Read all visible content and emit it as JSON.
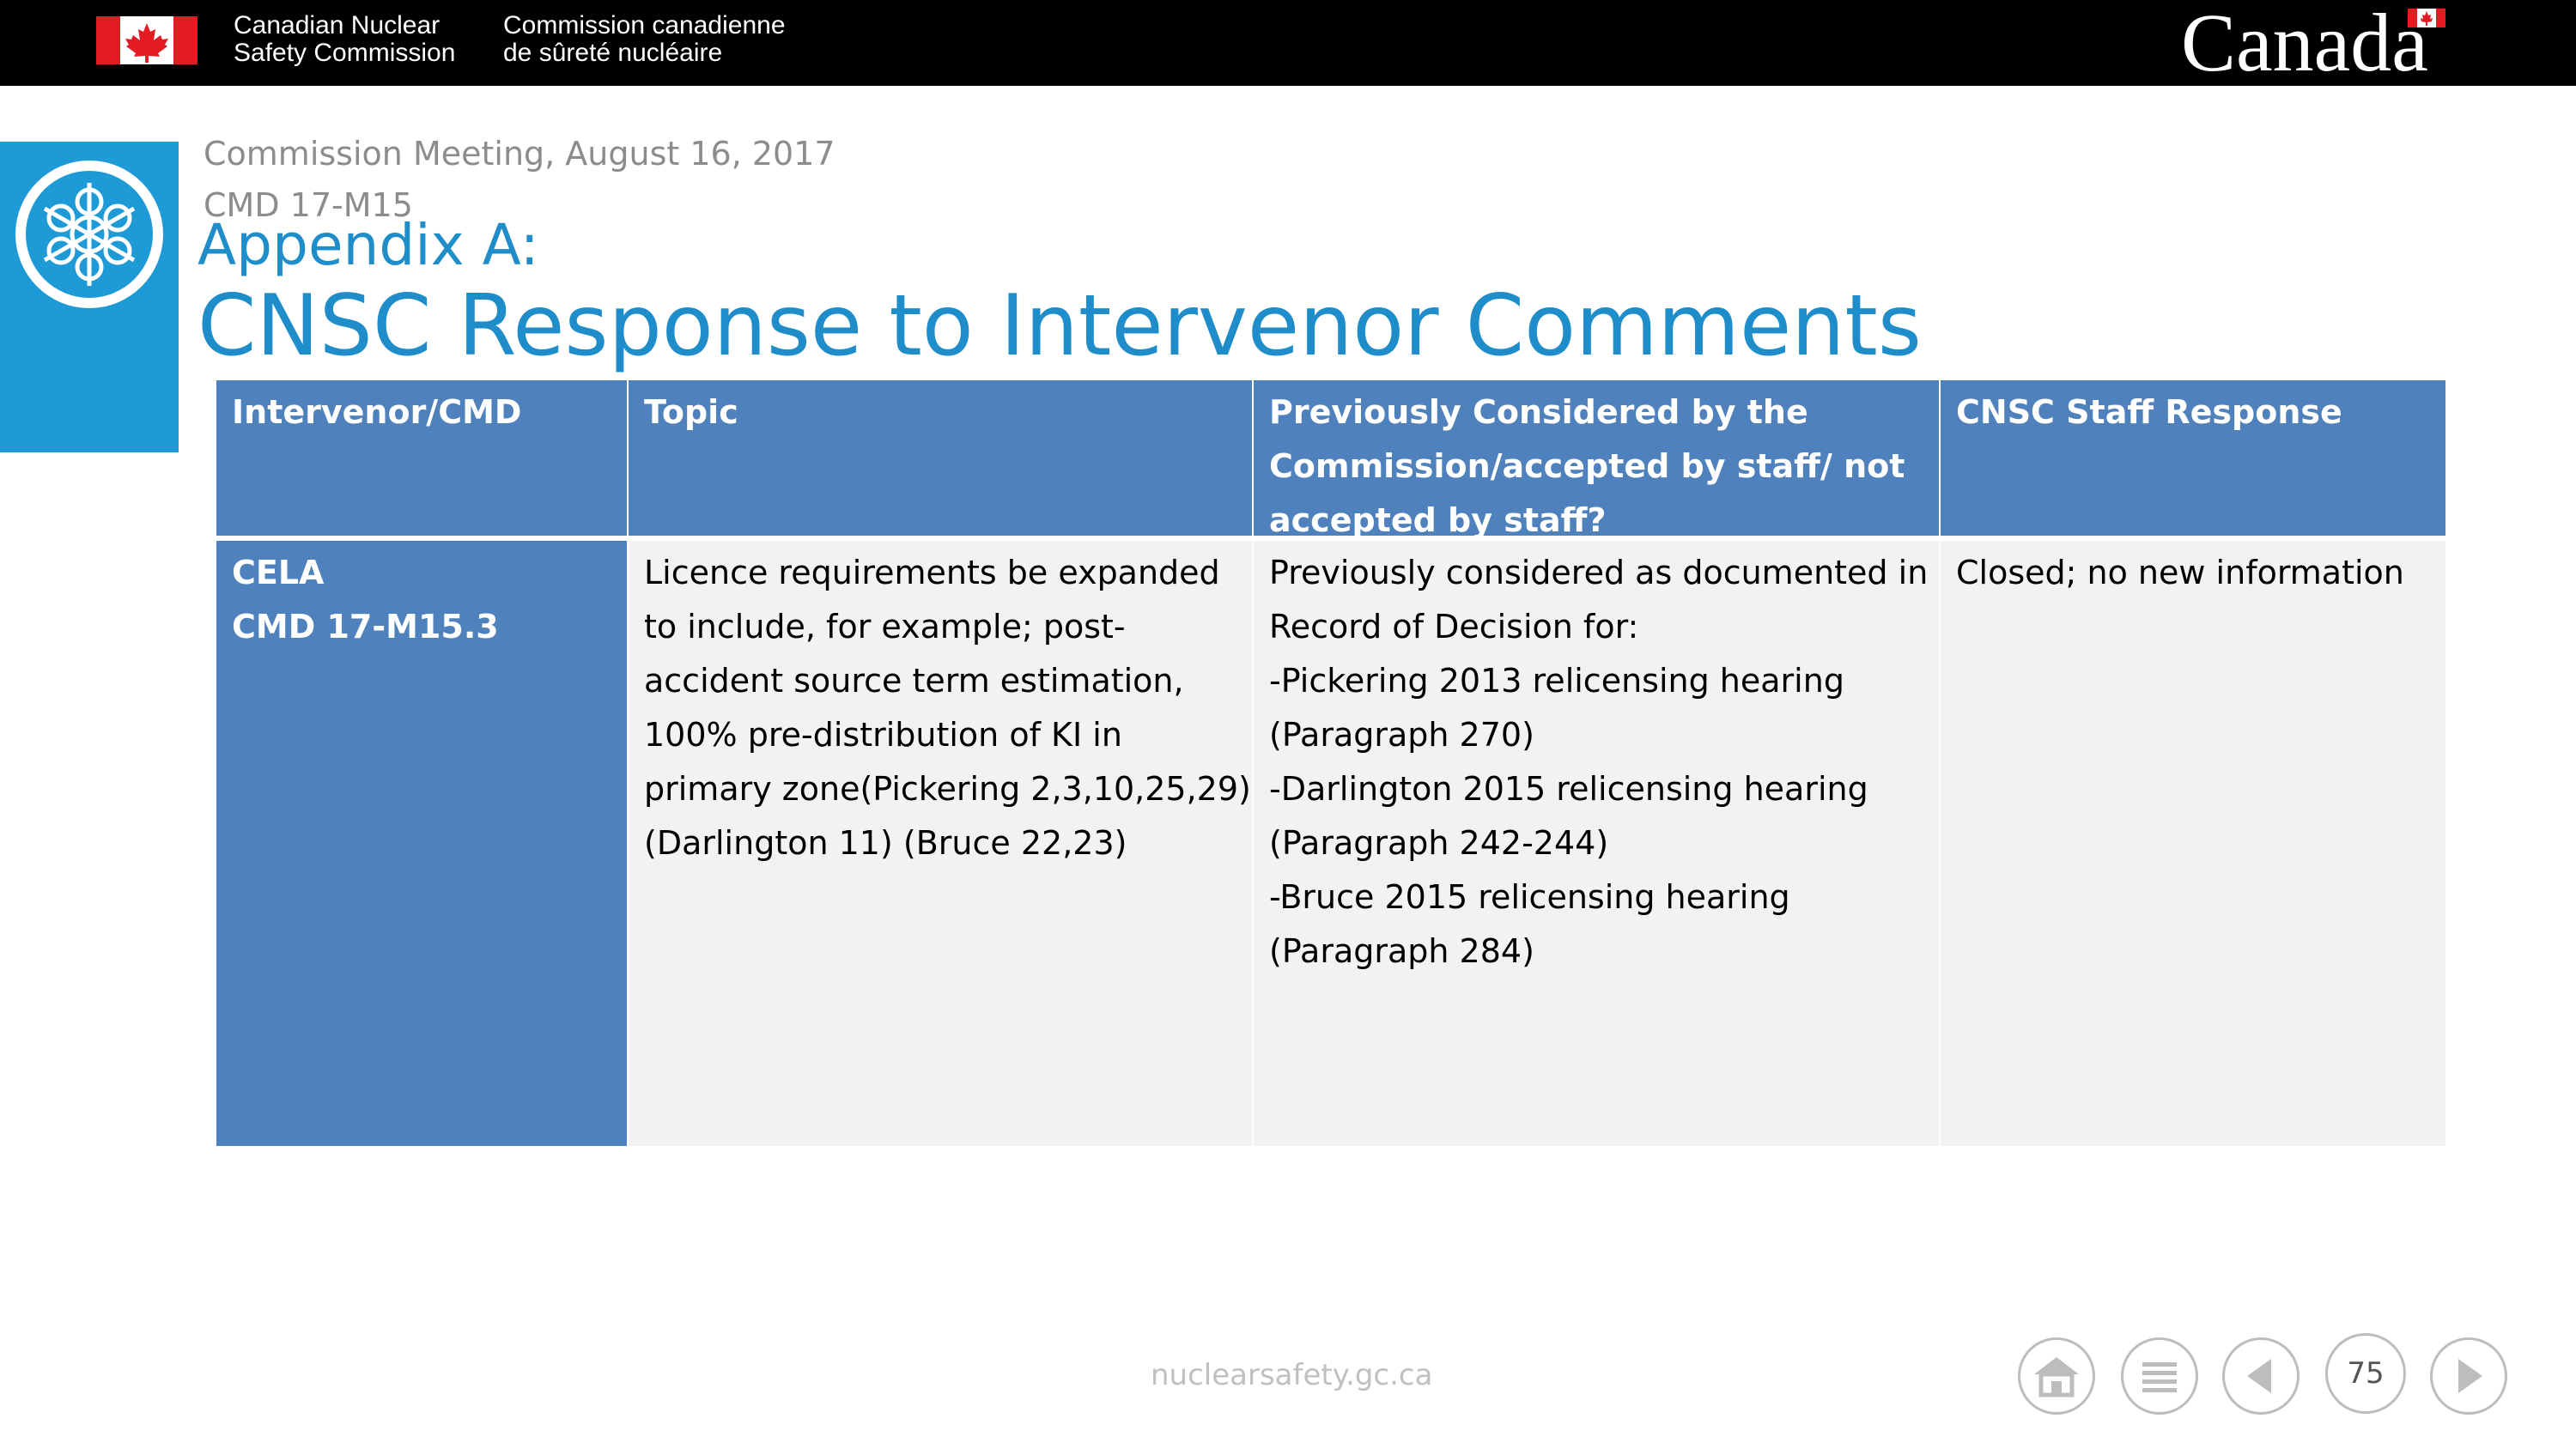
{
  "header": {
    "agency_en": "Canadian Nuclear\nSafety Commission",
    "agency_fr": "Commission canadienne\nde sûreté nucléaire",
    "wordmark": "Canada",
    "icons": [
      "canada-flag-icon",
      "cnsc-emblem-icon"
    ]
  },
  "slide": {
    "meeting": "Commission Meeting, August 16, 2017",
    "cmd": "CMD 17-M15",
    "appendix": "Appendix A:",
    "title": "CNSC Response to Intervenor Comments"
  },
  "table": {
    "headers": [
      [
        "Intervenor/CMD"
      ],
      [
        "Topic"
      ],
      [
        "Previously Considered by the",
        "Commission/accepted by staff/ not",
        "accepted by staff?"
      ],
      [
        "CNSC Staff Response"
      ]
    ],
    "row": {
      "intervenor": [
        "CELA",
        "CMD 17-M15.3"
      ],
      "topic": [
        "Licence requirements be expanded",
        "to include, for example; post-",
        "accident source term estimation,",
        "100% pre-distribution of KI in",
        "primary zone(Pickering 2,3,10,25,29)",
        "(Darlington 11) (Bruce 22,23)"
      ],
      "previously": [
        "Previously considered as documented in",
        "Record of Decision for:",
        "-Pickering 2013 relicensing hearing",
        "(Paragraph 270)",
        "-Darlington 2015 relicensing hearing",
        "(Paragraph 242-244)",
        "-Bruce 2015 relicensing hearing",
        "(Paragraph 284)"
      ],
      "response": [
        "Closed; no new information"
      ]
    }
  },
  "footer": {
    "url": "nuclearsafety.gc.ca",
    "page_number": "75",
    "nav_icons": [
      "home-icon",
      "menu-icon",
      "previous-icon",
      "next-icon"
    ]
  },
  "colors": {
    "header_blue": "#4f81bd",
    "title_blue": "#1f8dc9",
    "emblem_blue": "#1e9ad6",
    "canada_red": "#e31b23"
  }
}
